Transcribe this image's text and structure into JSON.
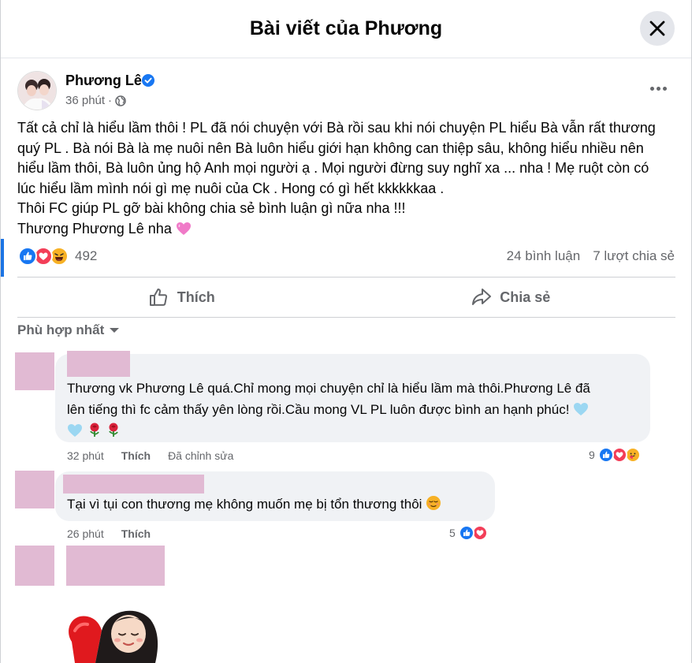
{
  "dialog": {
    "title": "Bài viết của Phương"
  },
  "post": {
    "author": "Phương Lê",
    "time": "36 phút",
    "separator": "·",
    "lines": [
      "Tất cả chỉ là hiểu lầm thôi ! PL đã nói chuyện với Bà rồi sau khi nói chuyện PL hiểu Bà vẫn rất thương",
      "quý PL . Bà nói Bà là mẹ nuôi nên Bà luôn hiểu giới hạn không can thiệp sâu, không hiểu nhiều nên",
      "hiểu lầm thôi, Bà luôn ủng hộ Anh mọi người ạ . Mọi người đừng suy nghĩ xa ... nha ! Mẹ ruột còn có",
      "lúc hiểu lầm mình nói gì mẹ nuôi của Ck . Hong có gì hết kkkkkkaa .",
      "Thôi FC giúp PL gỡ bài không chia sẻ bình luận gì nữa nha !!!",
      "Thương Phương Lê nha"
    ],
    "reaction_count": "492",
    "comments_count": "24 bình luận",
    "shares_count": "7 lượt chia sẻ"
  },
  "actions": {
    "like": "Thích",
    "share": "Chia sẻ"
  },
  "sort_label": "Phù hợp nhất",
  "comments": [
    {
      "text_line1": "Thương vk Phương Lê quá.Chỉ mong mọi chuyện chỉ là hiểu lầm mà thôi.Phương Lê đã",
      "text_line2": "lên tiếng thì fc cảm thấy yên lòng rồi.Cầu mong VL PL luôn được bình an hạnh phúc!",
      "time": "32 phút",
      "like": "Thích",
      "edited": "Đã chỉnh sửa",
      "reactions": "9"
    },
    {
      "text_line1": "Tại vì tụi con thương mẹ không muốn mẹ bị tổn thương thôi",
      "time": "26 phút",
      "like": "Thích",
      "reactions": "5"
    }
  ],
  "colors": {
    "accent": "#1b74e4",
    "like_blue": "#1877f2",
    "love_red": "#f33e58",
    "haha_yellow": "#f7b125",
    "redacted_pink": "#e1bad3"
  }
}
